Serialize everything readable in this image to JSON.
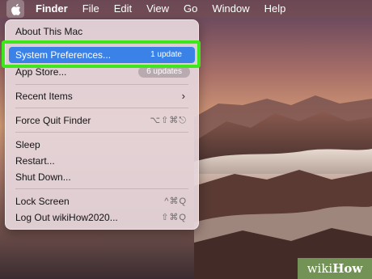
{
  "menubar": {
    "app": "Finder",
    "items": [
      "File",
      "Edit",
      "View",
      "Go",
      "Window",
      "Help"
    ]
  },
  "apple_menu": {
    "about": "About This Mac",
    "system_prefs": {
      "label": "System Preferences...",
      "badge": "1 update"
    },
    "app_store": {
      "label": "App Store...",
      "badge": "6 updates"
    },
    "recent_items": "Recent Items",
    "force_quit": {
      "label": "Force Quit Finder",
      "shortcut": "⌥⇧⌘⎋"
    },
    "sleep": "Sleep",
    "restart": "Restart...",
    "shut_down": "Shut Down...",
    "lock_screen": {
      "label": "Lock Screen",
      "shortcut": "^⌘Q"
    },
    "log_out": {
      "label": "Log Out wikiHow2020...",
      "shortcut": "⇧⌘Q"
    }
  },
  "watermark": {
    "prefix": "wiki",
    "suffix": "How"
  },
  "colors": {
    "selection": "#3b82e8",
    "highlight_box": "#3ee61c"
  }
}
